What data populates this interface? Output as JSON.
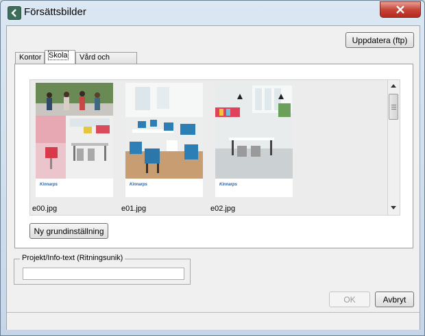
{
  "window": {
    "title": "Försättsbilder"
  },
  "toolbar": {
    "update_label": "Uppdatera (ftp)"
  },
  "tabs": [
    {
      "label": "Kontor"
    },
    {
      "label": "Skola"
    },
    {
      "label": "Vård och omsorg"
    }
  ],
  "gallery": {
    "items": [
      {
        "label": "e00.jpg"
      },
      {
        "label": "e01.jpg"
      },
      {
        "label": "e02.jpg"
      }
    ],
    "logo_text": "Kinnarps"
  },
  "reset_button": {
    "label": "Ny grundinställning"
  },
  "project_group": {
    "legend": "Projekt/Info-text (Ritningsunik)",
    "value": ""
  },
  "dialog": {
    "ok_label": "OK",
    "cancel_label": "Avbryt"
  },
  "icons": {
    "back": "back-arrow-icon",
    "close": "close-icon"
  },
  "colors": {
    "accent": "#c8453a",
    "logo": "#2a5fa4"
  }
}
